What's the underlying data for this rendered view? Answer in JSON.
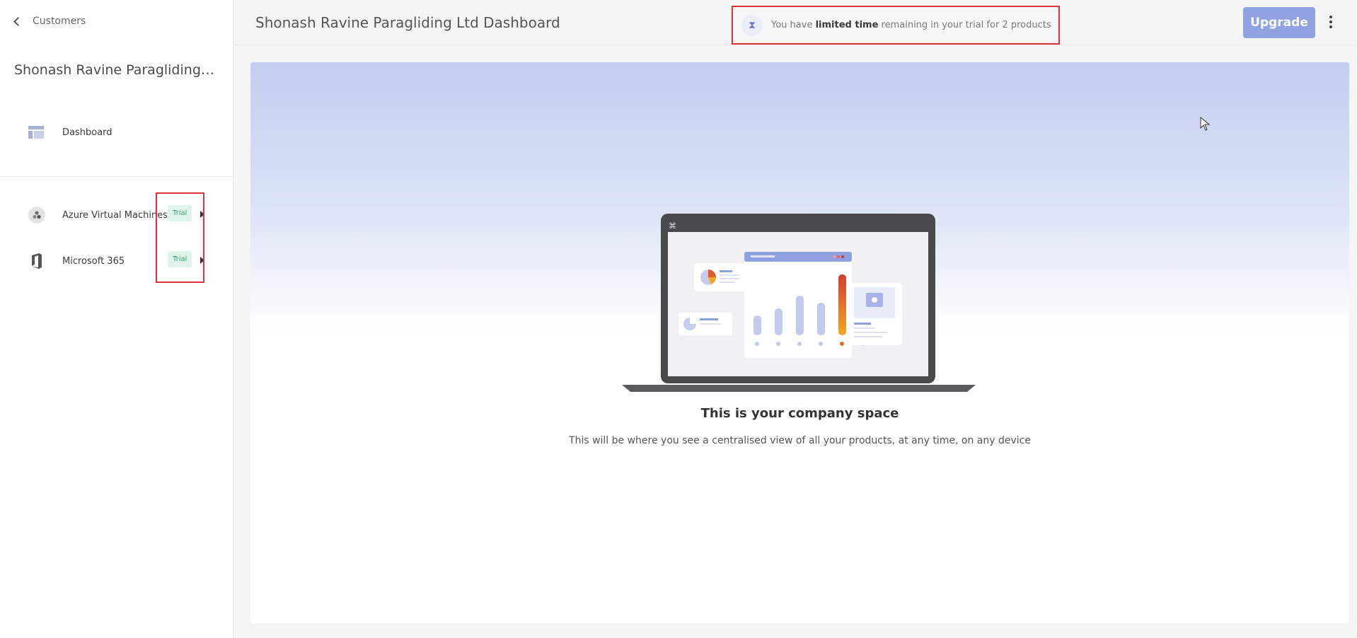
{
  "sidebar": {
    "back_label": "Customers",
    "company_name": "Shonash Ravine Paragliding Ltd",
    "nav": {
      "dashboard": "Dashboard"
    },
    "products": [
      {
        "name": "Azure Virtual Machines",
        "badge": "Trial",
        "icon": "azure-vm-icon"
      },
      {
        "name": "Microsoft 365",
        "badge": "Trial",
        "icon": "office-icon"
      }
    ]
  },
  "header": {
    "title": "Shonash Ravine Paragliding Ltd Dashboard",
    "notice": {
      "prefix": "You have",
      "bold": "limited time",
      "suffix": "remaining in your trial for 2 products"
    },
    "upgrade_label": "Upgrade"
  },
  "main": {
    "empty_title": "This is your company space",
    "empty_subtitle": "This will be where you see a centralised view of all your products, at any time, on any device"
  },
  "colors": {
    "accent": "#8fa3e0",
    "trial_bg": "#dff5ea",
    "trial_text": "#39a56e",
    "highlight": "#e0323a"
  }
}
